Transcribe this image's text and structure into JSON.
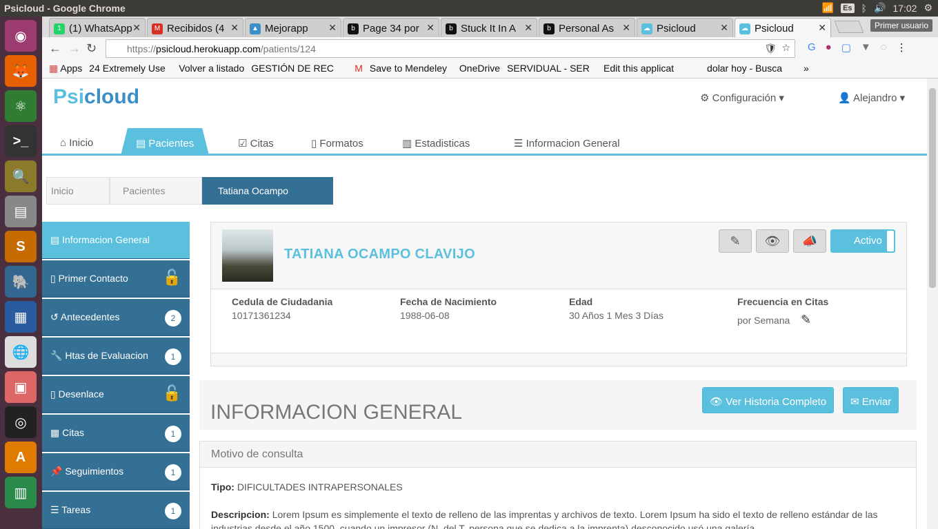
{
  "os": {
    "window_title": "Psicloud - Google Chrome",
    "keyboard": "Es",
    "clock": "17:02"
  },
  "browser": {
    "tabs": [
      {
        "label": "(1) WhatsApp",
        "fav": "1",
        "fav_color": "#25d366"
      },
      {
        "label": "Recibidos (4",
        "fav": "M",
        "fav_color": "#d93025"
      },
      {
        "label": "Mejorapp",
        "fav": "▲",
        "fav_color": "#3a8fc7"
      },
      {
        "label": "Page 34 por",
        "fav": "b",
        "fav_color": "#111111"
      },
      {
        "label": "Stuck It In A",
        "fav": "b",
        "fav_color": "#111111"
      },
      {
        "label": "Personal As",
        "fav": "b",
        "fav_color": "#111111"
      },
      {
        "label": "Psicloud",
        "fav": "☁",
        "fav_color": "#5bc0de"
      },
      {
        "label": "Psicloud",
        "fav": "☁",
        "fav_color": "#5bc0de"
      }
    ],
    "profile": "Primer usuario",
    "url_scheme": "https://",
    "url_host": "psicloud.herokuapp.com",
    "url_path": "/patients/124",
    "bookmarks": [
      "Apps",
      "24 Extremely Use",
      "Volver a listado",
      "GESTIÓN DE REC",
      "",
      "Save to Mendeley",
      "OneDrive",
      "SERVIDUAL - SER",
      "Edit this applicat",
      "dolar hoy - Busca"
    ]
  },
  "app": {
    "logo_prefix": "Psi",
    "logo_suffix": "cloud",
    "config_label": "Configuración",
    "user_label": "Alejandro",
    "nav": [
      "Inicio",
      "Pacientes",
      "Citas",
      "Formatos",
      "Estadisticas",
      "Informacion General"
    ],
    "breadcrumbs": [
      "Inicio",
      "Pacientes",
      "Tatiana Ocampo"
    ],
    "sidebar": [
      {
        "label": "Informacion General",
        "badge": ""
      },
      {
        "label": "Primer Contacto",
        "badge": ""
      },
      {
        "label": "Antecedentes",
        "badge": "2"
      },
      {
        "label": "Htas de Evaluacion",
        "badge": "1"
      },
      {
        "label": "Desenlace",
        "badge": ""
      },
      {
        "label": "Citas",
        "badge": "1"
      },
      {
        "label": "Seguimientos",
        "badge": "1"
      },
      {
        "label": "Tareas",
        "badge": "1"
      }
    ],
    "patient": {
      "name": "TATIANA OCAMPO CLAVIJO",
      "status": "Activo",
      "cedula_label": "Cedula de Ciudadania",
      "cedula": "10171361234",
      "fecha_label": "Fecha de Nacimiento",
      "fecha": "1988-06-08",
      "edad_label": "Edad",
      "edad": "30 Años 1 Mes 3 Días",
      "frecuencia_label": "Frecuencia en Citas",
      "frecuencia": "por Semana"
    },
    "section_title": "INFORMACION GENERAL",
    "btn_historia": "Ver Historia Completo",
    "btn_enviar": "Enviar",
    "motivo_title": "Motivo de consulta",
    "tipo_label": "Tipo:",
    "tipo_value": "DIFICULTADES INTRAPERSONALES",
    "descripcion_label": "Descripcion:",
    "descripcion_value": "Lorem Ipsum es simplemente el texto de relleno de las imprentas y archivos de texto. Lorem Ipsum ha sido el texto de relleno estándar de las industrias desde el año 1500, cuando un impresor (N. del T. persona que se dedica a la imprenta) desconocido usó una galería"
  }
}
